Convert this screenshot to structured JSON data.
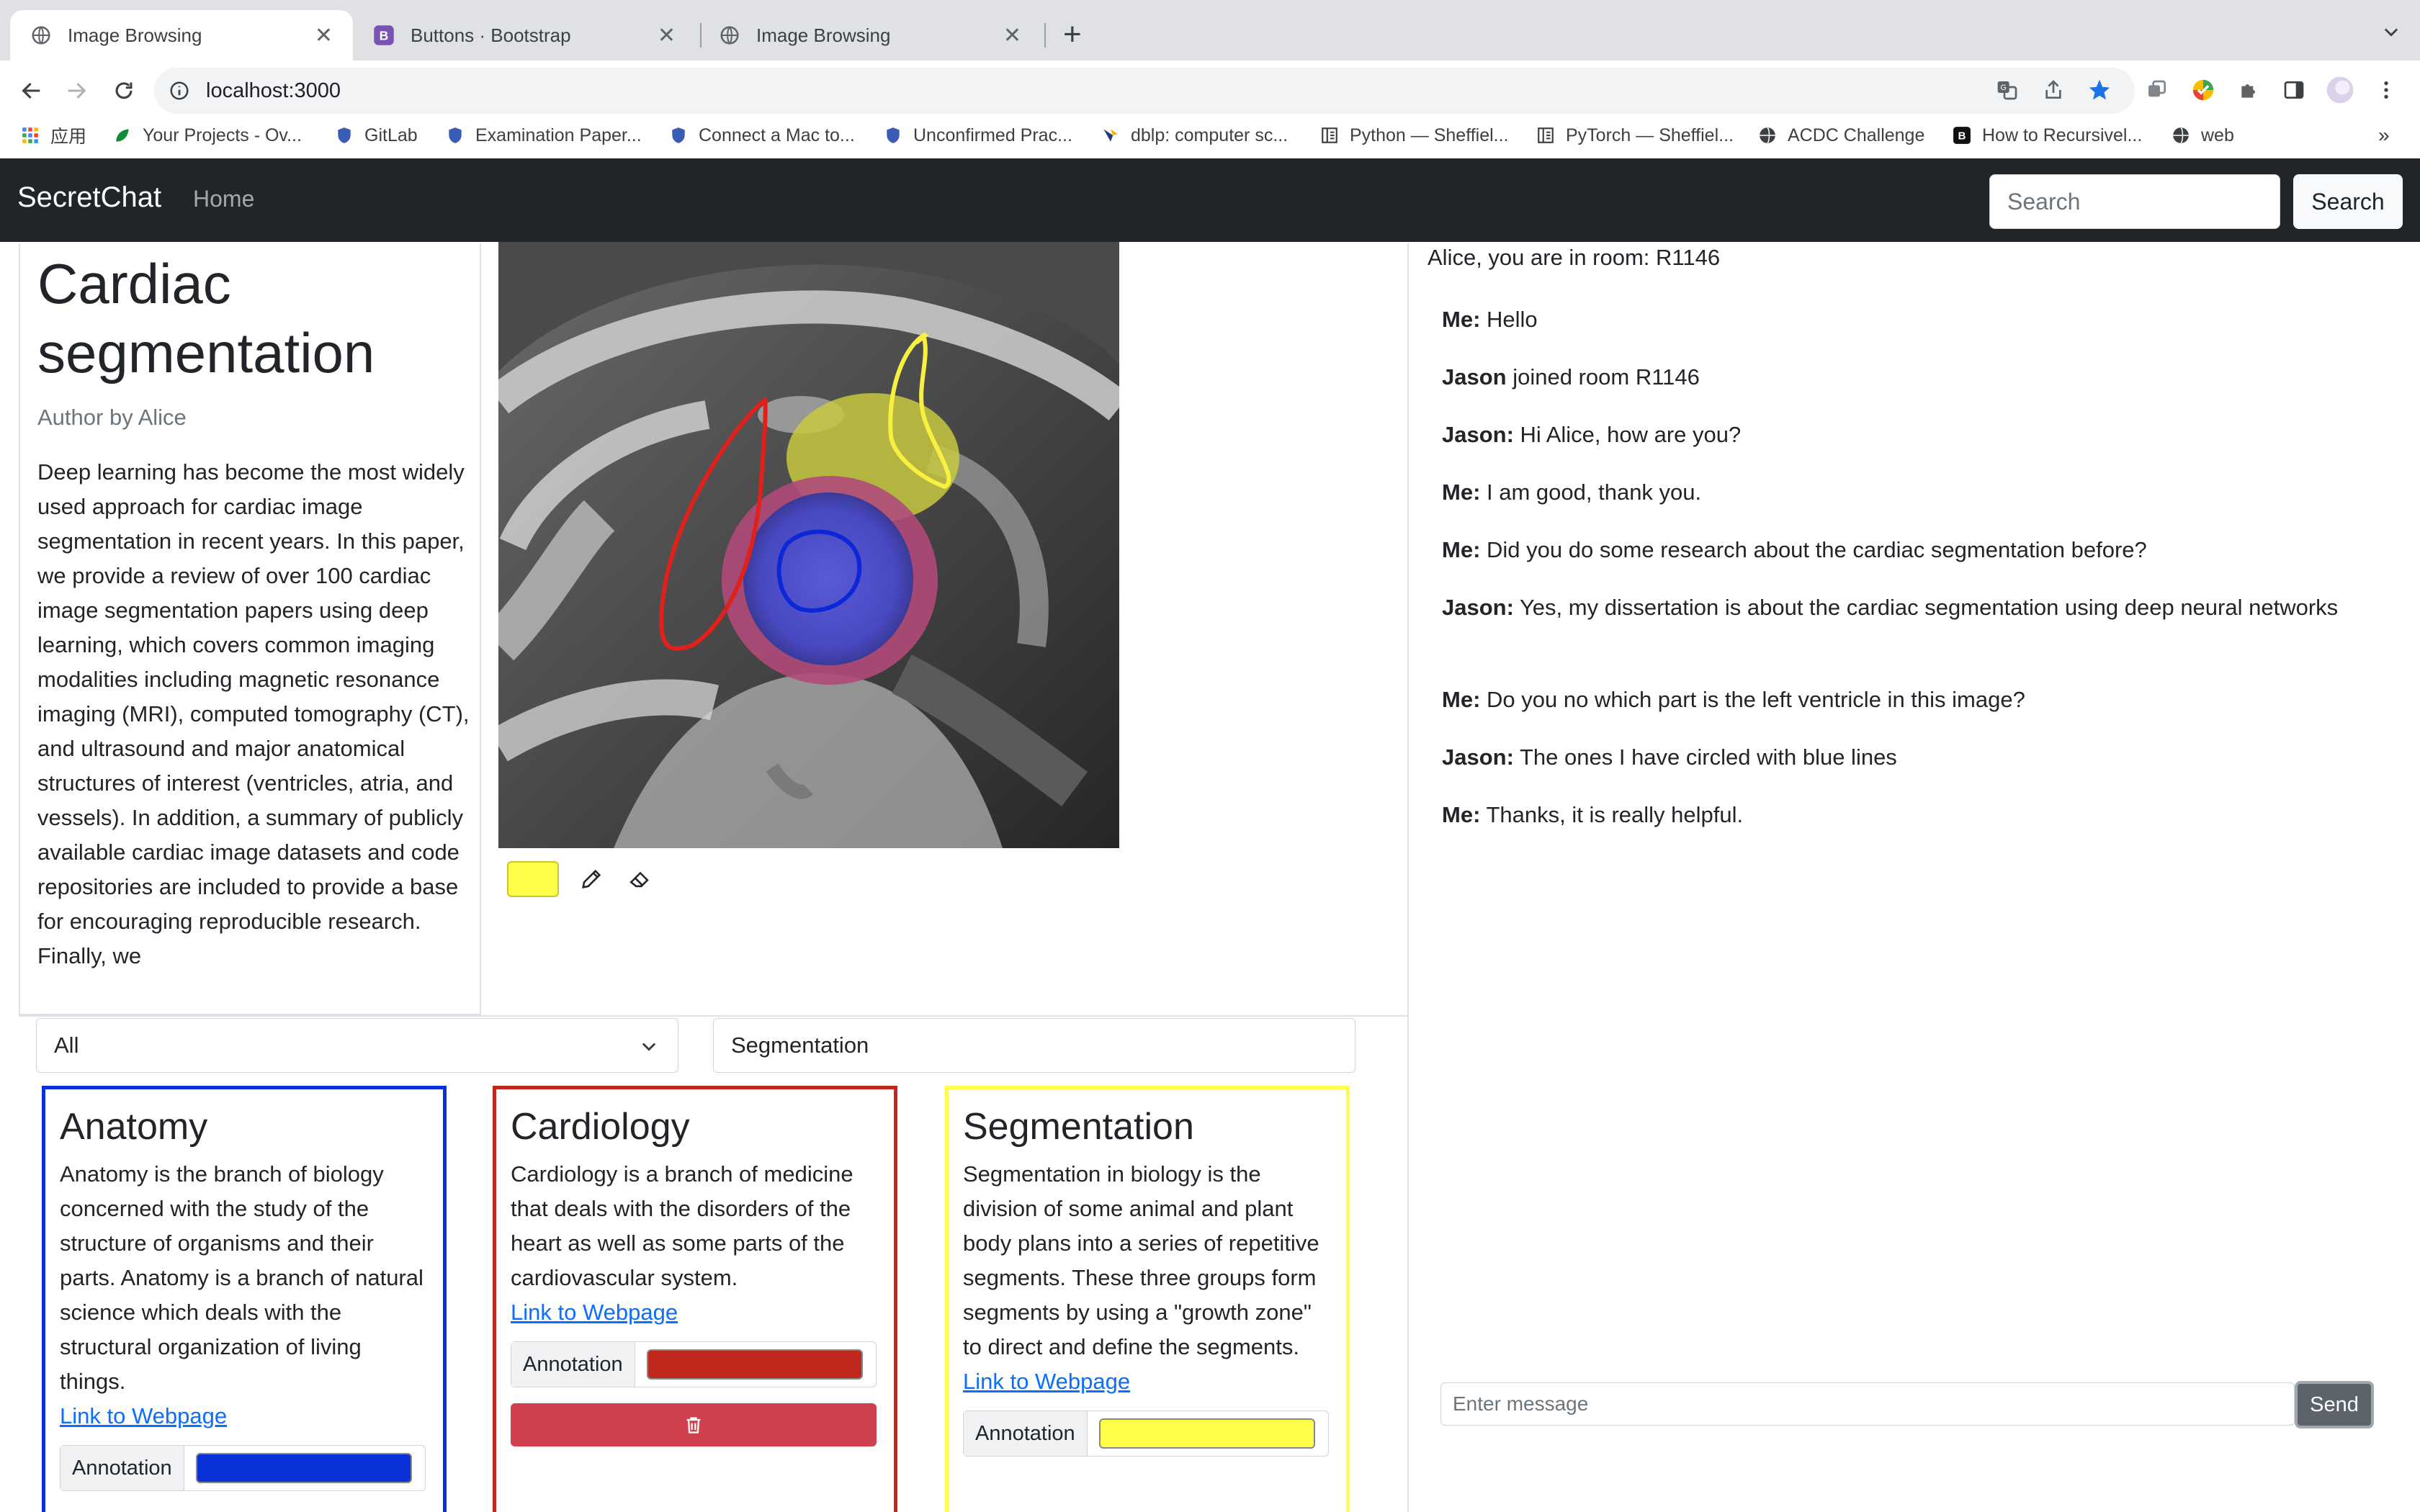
{
  "browser": {
    "tabs": [
      {
        "title": "Image Browsing"
      },
      {
        "title": "Buttons · Bootstrap"
      },
      {
        "title": "Image Browsing"
      }
    ],
    "url": "localhost:3000",
    "bookmarks": [
      {
        "label": "应用"
      },
      {
        "label": "Your Projects - Ov..."
      },
      {
        "label": "GitLab"
      },
      {
        "label": "Examination Paper..."
      },
      {
        "label": "Connect a Mac to..."
      },
      {
        "label": "Unconfirmed Prac..."
      },
      {
        "label": "dblp: computer sc..."
      },
      {
        "label": "Python — Sheffiel..."
      },
      {
        "label": "PyTorch — Sheffiel..."
      },
      {
        "label": "ACDC Challenge"
      },
      {
        "label": "How to Recursivel..."
      },
      {
        "label": "web"
      }
    ],
    "more_bookmarks": "»"
  },
  "navbar": {
    "brand": "SecretChat",
    "home": "Home",
    "search_placeholder": "Search",
    "search_button": "Search"
  },
  "article": {
    "title": "Cardiac segmentation",
    "author": "Author by Alice",
    "body": "Deep learning has become the most widely used approach for cardiac image segmentation in recent years. In this paper, we provide a review of over 100 cardiac image segmentation papers using deep learning, which covers common imaging modalities including magnetic resonance imaging (MRI), computed tomography (CT), and ultrasound and major anatomical structures of interest (ventricles, atria, and vessels). In addition, a summary of publicly available cardiac image datasets and code repositories are included to provide a base for encouraging reproducible research. Finally, we"
  },
  "tools": {
    "current_color": "#ffff4a",
    "pencil_icon": "pencil-icon",
    "eraser_icon": "eraser-icon"
  },
  "chat": {
    "room_text": "Alice, you are in room: R1146",
    "messages": [
      {
        "sender": "Me:",
        "text": " Hello"
      },
      {
        "sender": "Jason",
        "text": " joined room R1146"
      },
      {
        "sender": "Jason:",
        "text": " Hi Alice, how are you?"
      },
      {
        "sender": "Me:",
        "text": " I am good, thank you."
      },
      {
        "sender": "Me:",
        "text": " Did you do some research about the cardiac segmentation before?"
      },
      {
        "sender": "Jason:",
        "text": " Yes, my dissertation is about the cardiac segmentation using deep neural networks"
      },
      {
        "sender": "Me:",
        "text": " Do you no which part is the left ventricle in this image?"
      },
      {
        "sender": "Jason:",
        "text": " The ones I have circled with blue lines"
      },
      {
        "sender": "Me:",
        "text": " Thanks, it is really helpful."
      }
    ],
    "input_placeholder": "Enter message",
    "send_label": "Send"
  },
  "filters": {
    "category_selected": "All",
    "search_value": "Segmentation"
  },
  "cards": [
    {
      "title": "Anatomy",
      "text": "Anatomy is the branch of biology concerned with the study of the structure of organisms and their parts. Anatomy is a branch of natural science which deals with the structural organization of living things.",
      "link": "Link to Webpage",
      "annotation_label": "Annotation",
      "color": "#0a30d8"
    },
    {
      "title": "Cardiology",
      "text": "Cardiology is a branch of medicine that deals with the disorders of the heart as well as some parts of the cardiovascular system.",
      "link": "Link to Webpage",
      "annotation_label": "Annotation",
      "color": "#c0281e"
    },
    {
      "title": "Segmentation",
      "text": "Segmentation in biology is the division of some animal and plant body plans into a series of repetitive segments. These three groups form segments by using a \"growth zone\" to direct and define the segments.",
      "link": "Link to Webpage",
      "annotation_label": "Annotation",
      "color": "#ffff4a"
    }
  ]
}
